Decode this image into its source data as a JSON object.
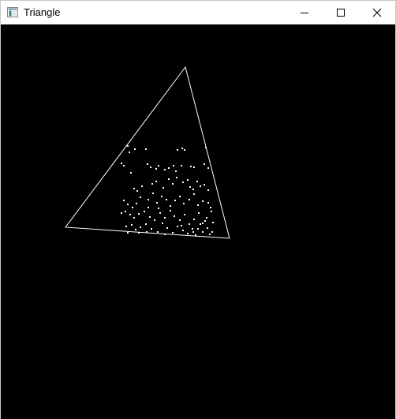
{
  "window": {
    "title": "Triangle",
    "app_icon": "window-app-icon",
    "controls": {
      "minimize_icon": "minimize-icon",
      "maximize_icon": "maximize-icon",
      "close_icon": "close-icon"
    }
  },
  "canvas": {
    "background": "#000000",
    "stroke_color": "#ffffff",
    "point_color": "#ffffff",
    "triangle_outline": "white",
    "point_count_visible": 110
  }
}
